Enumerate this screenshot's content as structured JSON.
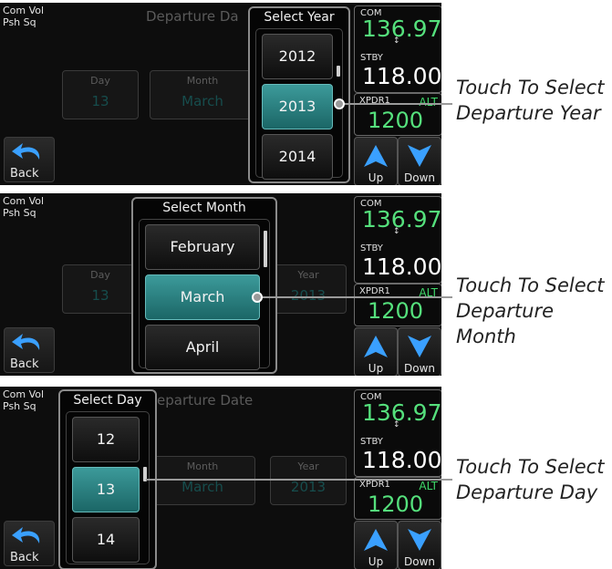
{
  "common": {
    "com_vol_line1": "Com Vol",
    "com_vol_line2": "Psh Sq",
    "back_label": "Back",
    "com_label": "COM",
    "com_freq": "136.97",
    "swap_icon": "↕",
    "stby_label": "STBY",
    "stby_freq": "118.00",
    "xpdr_label": "XPDR1",
    "xpdr_mode": "ALT",
    "xpdr_code": "1200",
    "up_label": "Up",
    "down_label": "Down"
  },
  "screen1": {
    "page_title": "Departure Da",
    "day_label": "Day",
    "day_value": "13",
    "month_label": "Month",
    "month_value": "March",
    "popup_title": "Select Year",
    "options": [
      "2012",
      "2013",
      "2014"
    ],
    "callout_line1": "Touch To Select",
    "callout_line2": "Departure Year"
  },
  "screen2": {
    "day_label": "Day",
    "day_value": "13",
    "year_label": "Year",
    "year_value": "2013",
    "popup_title": "Select Month",
    "options": [
      "February",
      "March",
      "April"
    ],
    "callout_line1": "Touch To Select",
    "callout_line2": "Departure Month"
  },
  "screen3": {
    "page_title": "eparture Date",
    "month_label": "Month",
    "month_value": "March",
    "year_label": "Year",
    "year_value": "2013",
    "popup_title": "Select Day",
    "options": [
      "12",
      "13",
      "14"
    ],
    "callout_line1": "Touch To Select",
    "callout_line2": "Departure Day"
  },
  "colors": {
    "selected_option": "#2a8080",
    "frequency_green": "#55e07c",
    "field_value_teal": "#1a6e6e"
  },
  "icons": [
    "back-arrow-icon",
    "swap-arrows-icon",
    "up-arrow-icon",
    "down-arrow-icon"
  ]
}
